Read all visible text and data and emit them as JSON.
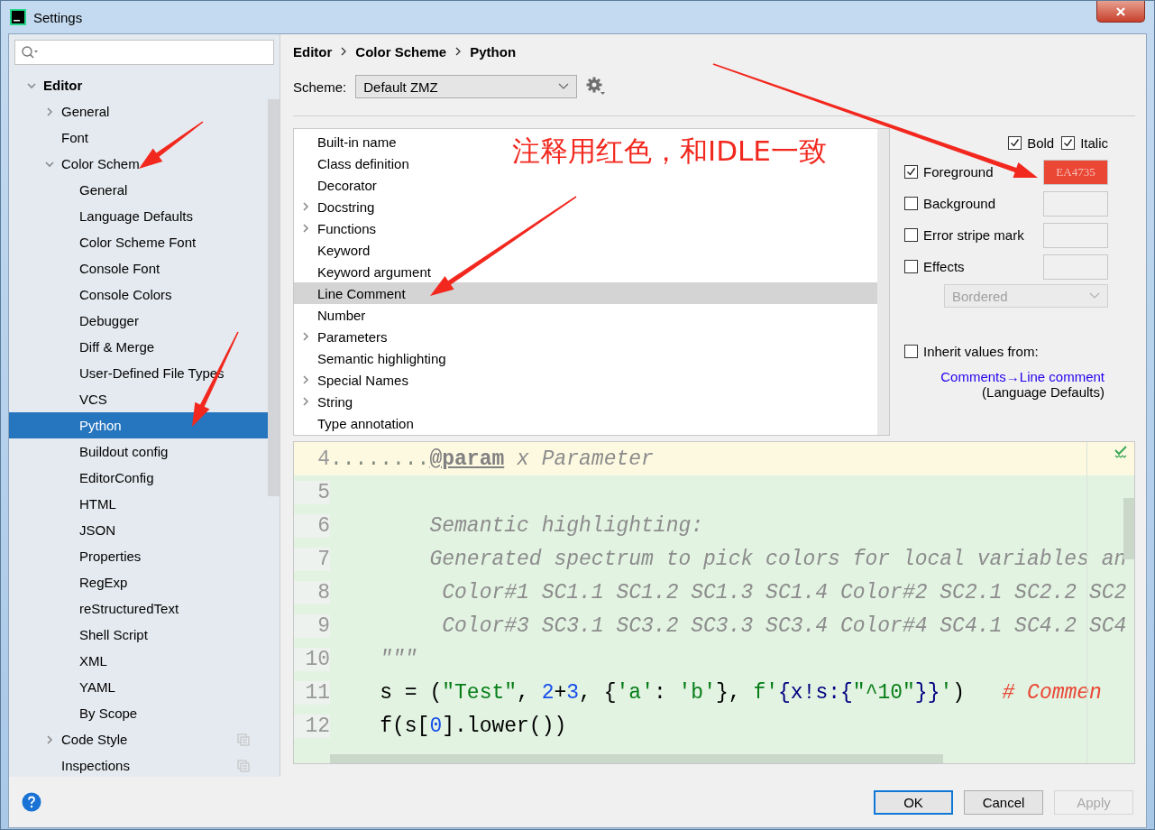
{
  "window": {
    "title": "Settings"
  },
  "tree": [
    {
      "label": "Editor",
      "expanded": true,
      "selected": false,
      "children": [
        {
          "label": "General",
          "expanded": false,
          "selected": false
        },
        {
          "label": "Font",
          "selected": false
        },
        {
          "label": "Color Schem",
          "expanded": true,
          "selected": false,
          "children": [
            {
              "label": "General",
              "selected": false
            },
            {
              "label": "Language Defaults",
              "selected": false
            },
            {
              "label": "Color Scheme Font",
              "selected": false
            },
            {
              "label": "Console Font",
              "selected": false
            },
            {
              "label": "Console Colors",
              "selected": false
            },
            {
              "label": "Debugger",
              "selected": false
            },
            {
              "label": "Diff & Merge",
              "selected": false
            },
            {
              "label": "User-Defined File Types",
              "selected": false
            },
            {
              "label": "VCS",
              "selected": false
            },
            {
              "label": "Python",
              "selected": true
            },
            {
              "label": "Buildout config",
              "selected": false
            },
            {
              "label": "EditorConfig",
              "selected": false
            },
            {
              "label": "HTML",
              "selected": false
            },
            {
              "label": "JSON",
              "selected": false
            },
            {
              "label": "Properties",
              "selected": false
            },
            {
              "label": "RegExp",
              "selected": false
            },
            {
              "label": "reStructuredText",
              "selected": false
            },
            {
              "label": "Shell Script",
              "selected": false
            },
            {
              "label": "XML",
              "selected": false
            },
            {
              "label": "YAML",
              "selected": false
            },
            {
              "label": "By Scope",
              "selected": false
            }
          ]
        },
        {
          "label": "Code Style",
          "expanded": false,
          "selected": false,
          "project_icon": true
        },
        {
          "label": "Inspections",
          "selected": false,
          "project_icon": true
        }
      ]
    }
  ],
  "breadcrumb": [
    "Editor",
    "Color Scheme",
    "Python"
  ],
  "scheme": {
    "label": "Scheme:",
    "value": "Default ZMZ"
  },
  "attributes": [
    {
      "label": "Built-in name",
      "selected": false
    },
    {
      "label": "Class definition",
      "selected": false
    },
    {
      "label": "Decorator",
      "selected": false
    },
    {
      "label": "Docstring",
      "expanded": false,
      "selected": false
    },
    {
      "label": "Functions",
      "expanded": false,
      "selected": false
    },
    {
      "label": "Keyword",
      "selected": false
    },
    {
      "label": "Keyword argument",
      "selected": false
    },
    {
      "label": "Line Comment",
      "selected": true
    },
    {
      "label": "Number",
      "selected": false
    },
    {
      "label": "Parameters",
      "expanded": false,
      "selected": false
    },
    {
      "label": "Semantic highlighting",
      "selected": false
    },
    {
      "label": "Special Names",
      "expanded": false,
      "selected": false
    },
    {
      "label": "String",
      "expanded": false,
      "selected": false
    },
    {
      "label": "Type annotation",
      "selected": false
    }
  ],
  "font_style": [
    {
      "label": "Bold",
      "checked": true
    },
    {
      "label": "Italic",
      "checked": true
    }
  ],
  "color_rows": [
    {
      "label": "Foreground",
      "checked": true,
      "color": "#ea4735",
      "value": "EA4735"
    },
    {
      "label": "Background",
      "checked": false
    },
    {
      "label": "Error stripe mark",
      "checked": false
    },
    {
      "label": "Effects",
      "checked": false
    }
  ],
  "effect_type": {
    "value": "Bordered",
    "disabled": true
  },
  "inherit": {
    "label": "Inherit values from:",
    "checked": false,
    "link": "Comments→Line comment",
    "note": "(Language Defaults)"
  },
  "preview": [
    {
      "number": "4",
      "current": true,
      "tokens": [
        {
          "kind": "whitespace",
          "text": "........"
        },
        {
          "kind": "doc-tag",
          "text": "@param"
        },
        {
          "kind": "docstring",
          "text": " x Parameter"
        }
      ]
    },
    {
      "number": "5",
      "current": false
    },
    {
      "number": "6",
      "current": false,
      "tokens": [
        {
          "kind": "docstring",
          "text": "        Semantic highlighting:"
        }
      ]
    },
    {
      "number": "7",
      "current": false,
      "tokens": [
        {
          "kind": "docstring",
          "text": "        Generated spectrum to pick colors for local variables an"
        }
      ]
    },
    {
      "number": "8",
      "current": false,
      "tokens": [
        {
          "kind": "docstring",
          "text": "         Color#1 SC1.1 SC1.2 SC1.3 SC1.4 Color#2 SC2.1 SC2.2 SC2"
        }
      ]
    },
    {
      "number": "9",
      "current": false,
      "tokens": [
        {
          "kind": "docstring",
          "text": "         Color#3 SC3.1 SC3.2 SC3.3 SC3.4 Color#4 SC4.1 SC4.2 SC4"
        }
      ]
    },
    {
      "number": "10",
      "current": false,
      "tokens": [
        {
          "kind": "docstring",
          "text": "    \"\"\""
        }
      ]
    },
    {
      "number": "11",
      "current": false,
      "tokens": [
        {
          "kind": "plain",
          "text": "    s = ("
        },
        {
          "kind": "string",
          "text": "\"Test\""
        },
        {
          "kind": "plain",
          "text": ", "
        },
        {
          "kind": "number",
          "text": "2"
        },
        {
          "kind": "plain",
          "text": "+"
        },
        {
          "kind": "number",
          "text": "3"
        },
        {
          "kind": "plain",
          "text": ", {"
        },
        {
          "kind": "string",
          "text": "'a'"
        },
        {
          "kind": "plain",
          "text": ": "
        },
        {
          "kind": "string",
          "text": "'b'"
        },
        {
          "kind": "plain",
          "text": "}, "
        },
        {
          "kind": "string",
          "text": "f'"
        },
        {
          "kind": "injected",
          "text": "{x!s:{"
        },
        {
          "kind": "string",
          "text": "\"^10\""
        },
        {
          "kind": "injected",
          "text": "}}"
        },
        {
          "kind": "string",
          "text": "'"
        },
        {
          "kind": "plain",
          "text": ")   "
        },
        {
          "kind": "comment",
          "text": "# Commen"
        }
      ]
    },
    {
      "number": "12",
      "current": false,
      "tokens": [
        {
          "kind": "plain",
          "text": "    f(s["
        },
        {
          "kind": "number",
          "text": "0"
        },
        {
          "kind": "plain",
          "text": "].lower())"
        }
      ]
    }
  ],
  "annotation": {
    "text": "注释用红色，和IDLE一致"
  },
  "buttons": [
    {
      "label": "OK",
      "kind": "default",
      "disabled": false
    },
    {
      "label": "Cancel",
      "kind": "normal",
      "disabled": false
    },
    {
      "label": "Apply",
      "kind": "normal",
      "disabled": true
    }
  ]
}
